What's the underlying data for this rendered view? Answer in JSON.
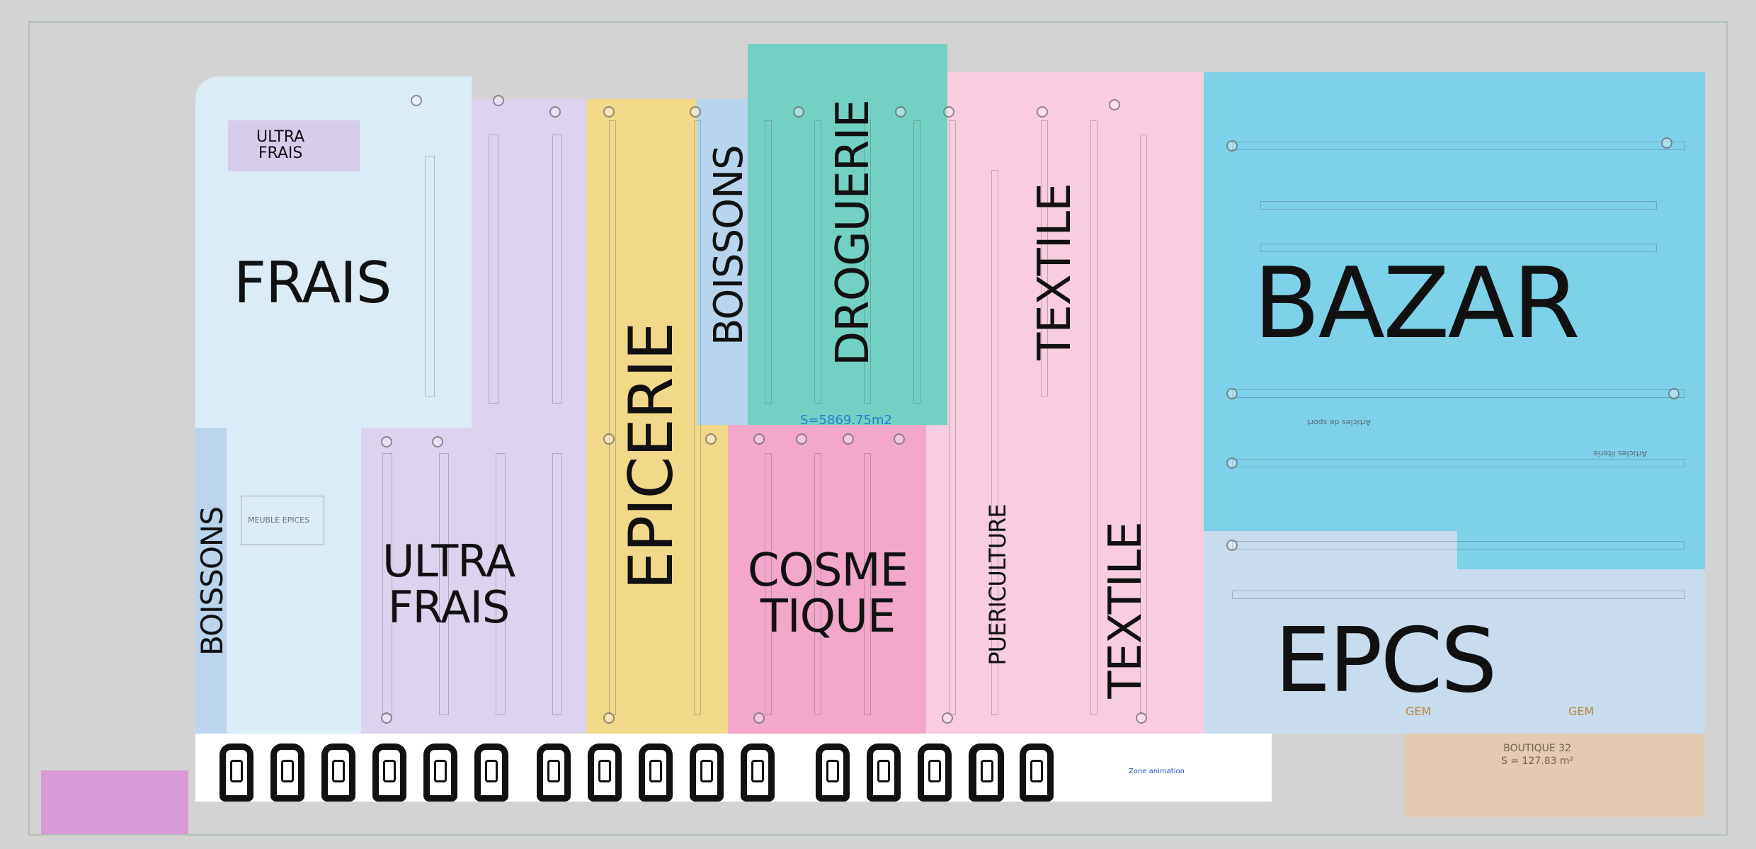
{
  "map": {
    "area_label": "S=5869.75m2",
    "zones": [
      {
        "id": "frais",
        "label": "FRAIS",
        "color": "#dcecf7"
      },
      {
        "id": "ultra-frais-top",
        "label_line1": "ULTRA",
        "label_line2": "FRAIS",
        "color": "#d6cdea"
      },
      {
        "id": "ultra-frais",
        "label_line1": "ULTRA",
        "label_line2": "FRAIS",
        "color": "#ddd3ee"
      },
      {
        "id": "boissons-left",
        "label": "BOISSONS",
        "color": "#bcd4ec"
      },
      {
        "id": "epicerie",
        "label": "EPICERIE",
        "color": "#f1d98a"
      },
      {
        "id": "boissons",
        "label": "BOISSONS",
        "color": "#b9d5ee"
      },
      {
        "id": "droguerie",
        "label": "DROGUERIE",
        "color": "#73d1c3"
      },
      {
        "id": "cosmetique",
        "label_line1": "COSME",
        "label_line2": "TIQUE",
        "color": "#f2a7cb"
      },
      {
        "id": "textile-top",
        "label": "TEXTILE",
        "color": "#f8cde0"
      },
      {
        "id": "puericulture",
        "label": "PUERICULTURE",
        "color": "#f8cde0"
      },
      {
        "id": "textile-bottom",
        "label": "TEXTILE",
        "color": "#f8cde0"
      },
      {
        "id": "bazar",
        "label": "BAZAR",
        "color": "#7dd2e9"
      },
      {
        "id": "epcs",
        "label": "EPCS",
        "color": "#c9dcee"
      },
      {
        "id": "boutique",
        "label_line1": "BOUTIQUE 32",
        "label_line2": "S = 127.83 m²",
        "color": "#e3cbb3"
      }
    ],
    "small_labels": {
      "meuble_epices": "MEUBLE EPICES",
      "gem_left": "GEM",
      "gem_right": "GEM",
      "zone_animation": "Zone animation",
      "articles_sport": "Articles de sport",
      "articles_literie": "Articles literie"
    },
    "checkout_count": 17
  }
}
